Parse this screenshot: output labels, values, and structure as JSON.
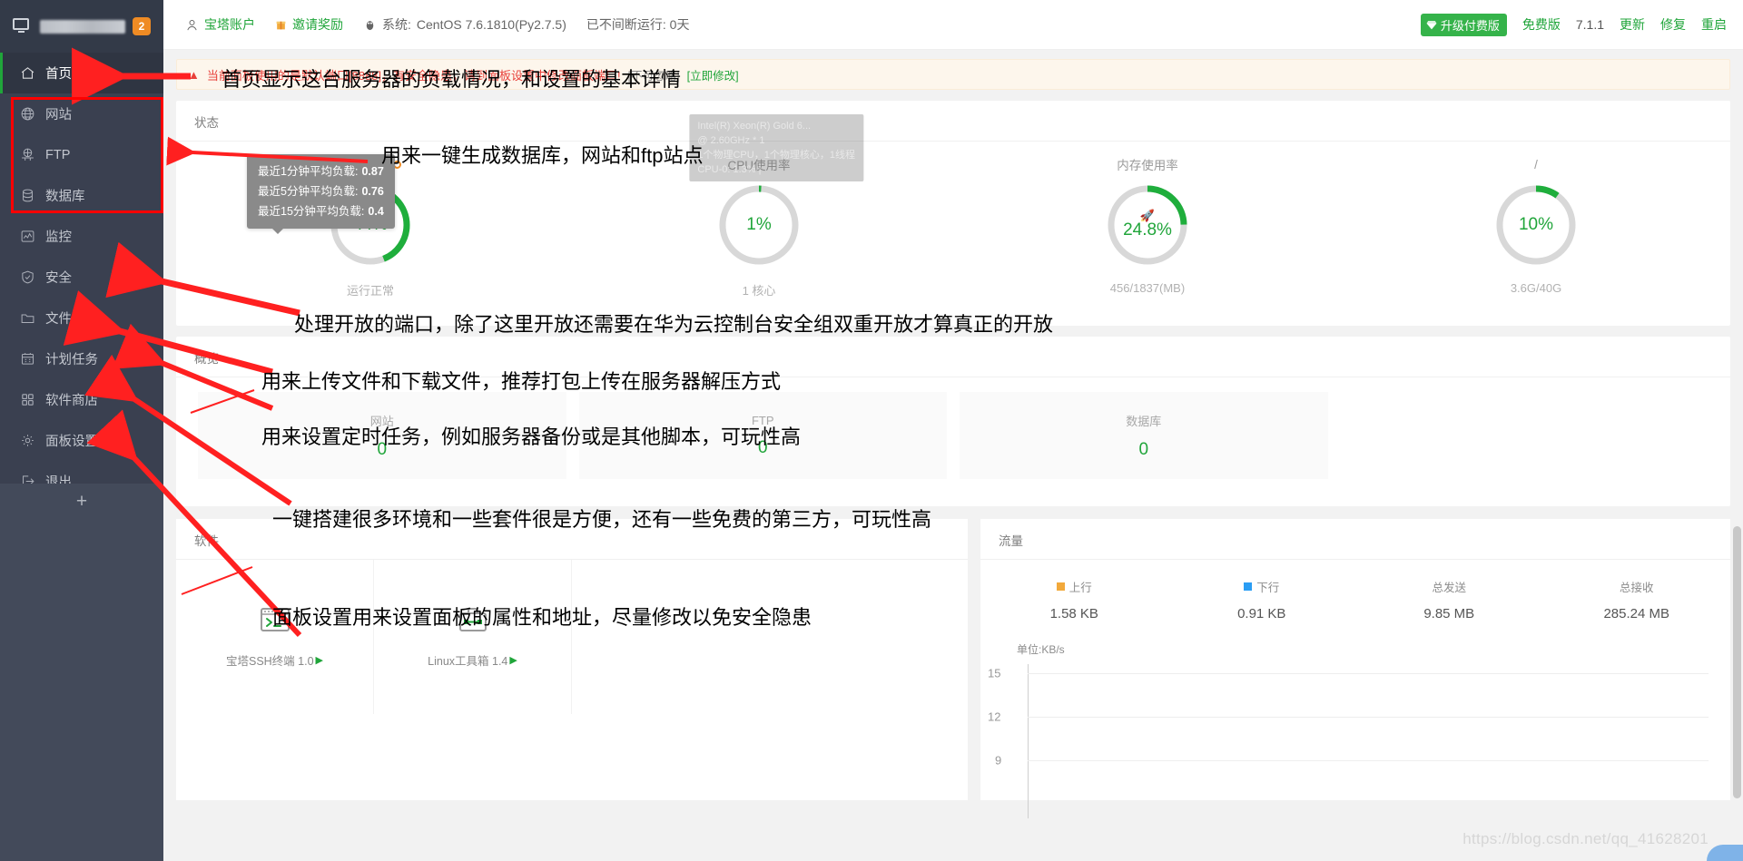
{
  "sidebar": {
    "badge": "2",
    "items": [
      {
        "label": "首页",
        "icon": "home-icon",
        "active": true
      },
      {
        "label": "网站",
        "icon": "globe-icon",
        "active": false
      },
      {
        "label": "FTP",
        "icon": "ftp-icon",
        "active": false
      },
      {
        "label": "数据库",
        "icon": "database-icon",
        "active": false
      },
      {
        "label": "监控",
        "icon": "monitor-chart-icon",
        "active": false
      },
      {
        "label": "安全",
        "icon": "shield-icon",
        "active": false
      },
      {
        "label": "文件",
        "icon": "folder-icon",
        "active": false
      },
      {
        "label": "计划任务",
        "icon": "calendar-icon",
        "active": false
      },
      {
        "label": "软件商店",
        "icon": "grid-apps-icon",
        "active": false
      },
      {
        "label": "面板设置",
        "icon": "gear-icon",
        "active": false
      },
      {
        "label": "退出",
        "icon": "logout-icon",
        "active": false
      }
    ],
    "add_label": "+"
  },
  "topbar": {
    "account_label": "宝塔账户",
    "invite_label": "邀请奖励",
    "system_key": "系统:",
    "system_value": "CentOS 7.6.1810(Py2.7.5)",
    "uptime": "已不间断运行: 0天",
    "upgrade_label": "升级付费版",
    "edition": "免费版",
    "version": "7.1.1",
    "actions": [
      "更新",
      "修复",
      "重启"
    ]
  },
  "warning": {
    "text": "当前面板使用的是默认端口[8888]，有安全隐患，请到面板设置中修改面板端口!",
    "ignore_label": "[不可忽略]",
    "fix_label": "[立即修改]"
  },
  "status": {
    "title": "状态",
    "load_tooltip": [
      {
        "label": "最近1分钟平均负载:",
        "value": "0.87"
      },
      {
        "label": "最近5分钟平均负载:",
        "value": "0.76"
      },
      {
        "label": "最近15分钟平均负载:",
        "value": "0.4"
      }
    ],
    "cpu_tooltip": "Intel(R) Xeon(R) Gold 6...\n@ 2.60GHz * 1\n1个物理CPU，1个物理核心，1线程\nCPU-0: 1.3% |",
    "gauges": [
      {
        "caption": "负载状态",
        "value": "44%",
        "percent": 44,
        "sub": "运行正常",
        "icon": "load-dot-icon"
      },
      {
        "caption": "CPU使用率",
        "value": "1%",
        "percent": 1,
        "sub": "1 核心",
        "icon": ""
      },
      {
        "caption": "内存使用率",
        "value": "24.8%",
        "percent": 24.8,
        "sub": "456/1837(MB)",
        "icon": "rocket-icon"
      },
      {
        "caption": "/",
        "value": "10%",
        "percent": 10,
        "sub": "3.6G/40G",
        "icon": ""
      }
    ]
  },
  "overview": {
    "title": "概览",
    "cells": [
      {
        "label": "网站",
        "count": "0"
      },
      {
        "label": "FTP",
        "count": "0"
      },
      {
        "label": "数据库",
        "count": "0"
      }
    ]
  },
  "software": {
    "title": "软件",
    "items": [
      {
        "name": "宝塔SSH终端 1.0",
        "icon": "terminal-icon"
      },
      {
        "name": "Linux工具箱 1.4",
        "icon": "toolbox-icon"
      }
    ]
  },
  "traffic": {
    "title": "流量",
    "stats": [
      {
        "label": "上行",
        "value": "1.58 KB",
        "swatch": "#f2a93b"
      },
      {
        "label": "下行",
        "value": "0.91 KB",
        "swatch": "#2a9df4"
      },
      {
        "label": "总发送",
        "value": "9.85 MB",
        "swatch": ""
      },
      {
        "label": "总接收",
        "value": "285.24 MB",
        "swatch": ""
      }
    ]
  },
  "chart_data": {
    "type": "line",
    "title": "",
    "unit_label": "单位:KB/s",
    "ylabel": "KB/s",
    "xlabel": "",
    "yticks": [
      "15",
      "12",
      "9"
    ],
    "ylim": [
      0,
      15
    ],
    "grid": true,
    "legend_position": "top",
    "series": [
      {
        "name": "上行",
        "color": "#f2a93b",
        "values": []
      },
      {
        "name": "下行",
        "color": "#2a9df4",
        "values": []
      }
    ],
    "x": []
  },
  "annotations": [
    {
      "id": "a1",
      "text": "首页显示这台服务器的负载情况，和设置的基本详情"
    },
    {
      "id": "a2",
      "text": "用来一键生成数据库，网站和ftp站点"
    },
    {
      "id": "a3",
      "text": "处理开放的端口，除了这里开放还需要在华为云控制台安全组双重开放才算真正的开放"
    },
    {
      "id": "a4",
      "text": "用来上传文件和下载文件，推荐打包上传在服务器解压方式"
    },
    {
      "id": "a5",
      "text": "用来设置定时任务，例如服务器备份或是其他脚本，可玩性高"
    },
    {
      "id": "a6",
      "text": "一键搭建很多环境和一些套件很是方便，还有一些免费的第三方，可玩性高"
    },
    {
      "id": "a7",
      "text": "面板设置用来设置面板的属性和地址，尽量修改以免安全隐患"
    }
  ],
  "watermark": "https://blog.csdn.net/qq_41628201"
}
